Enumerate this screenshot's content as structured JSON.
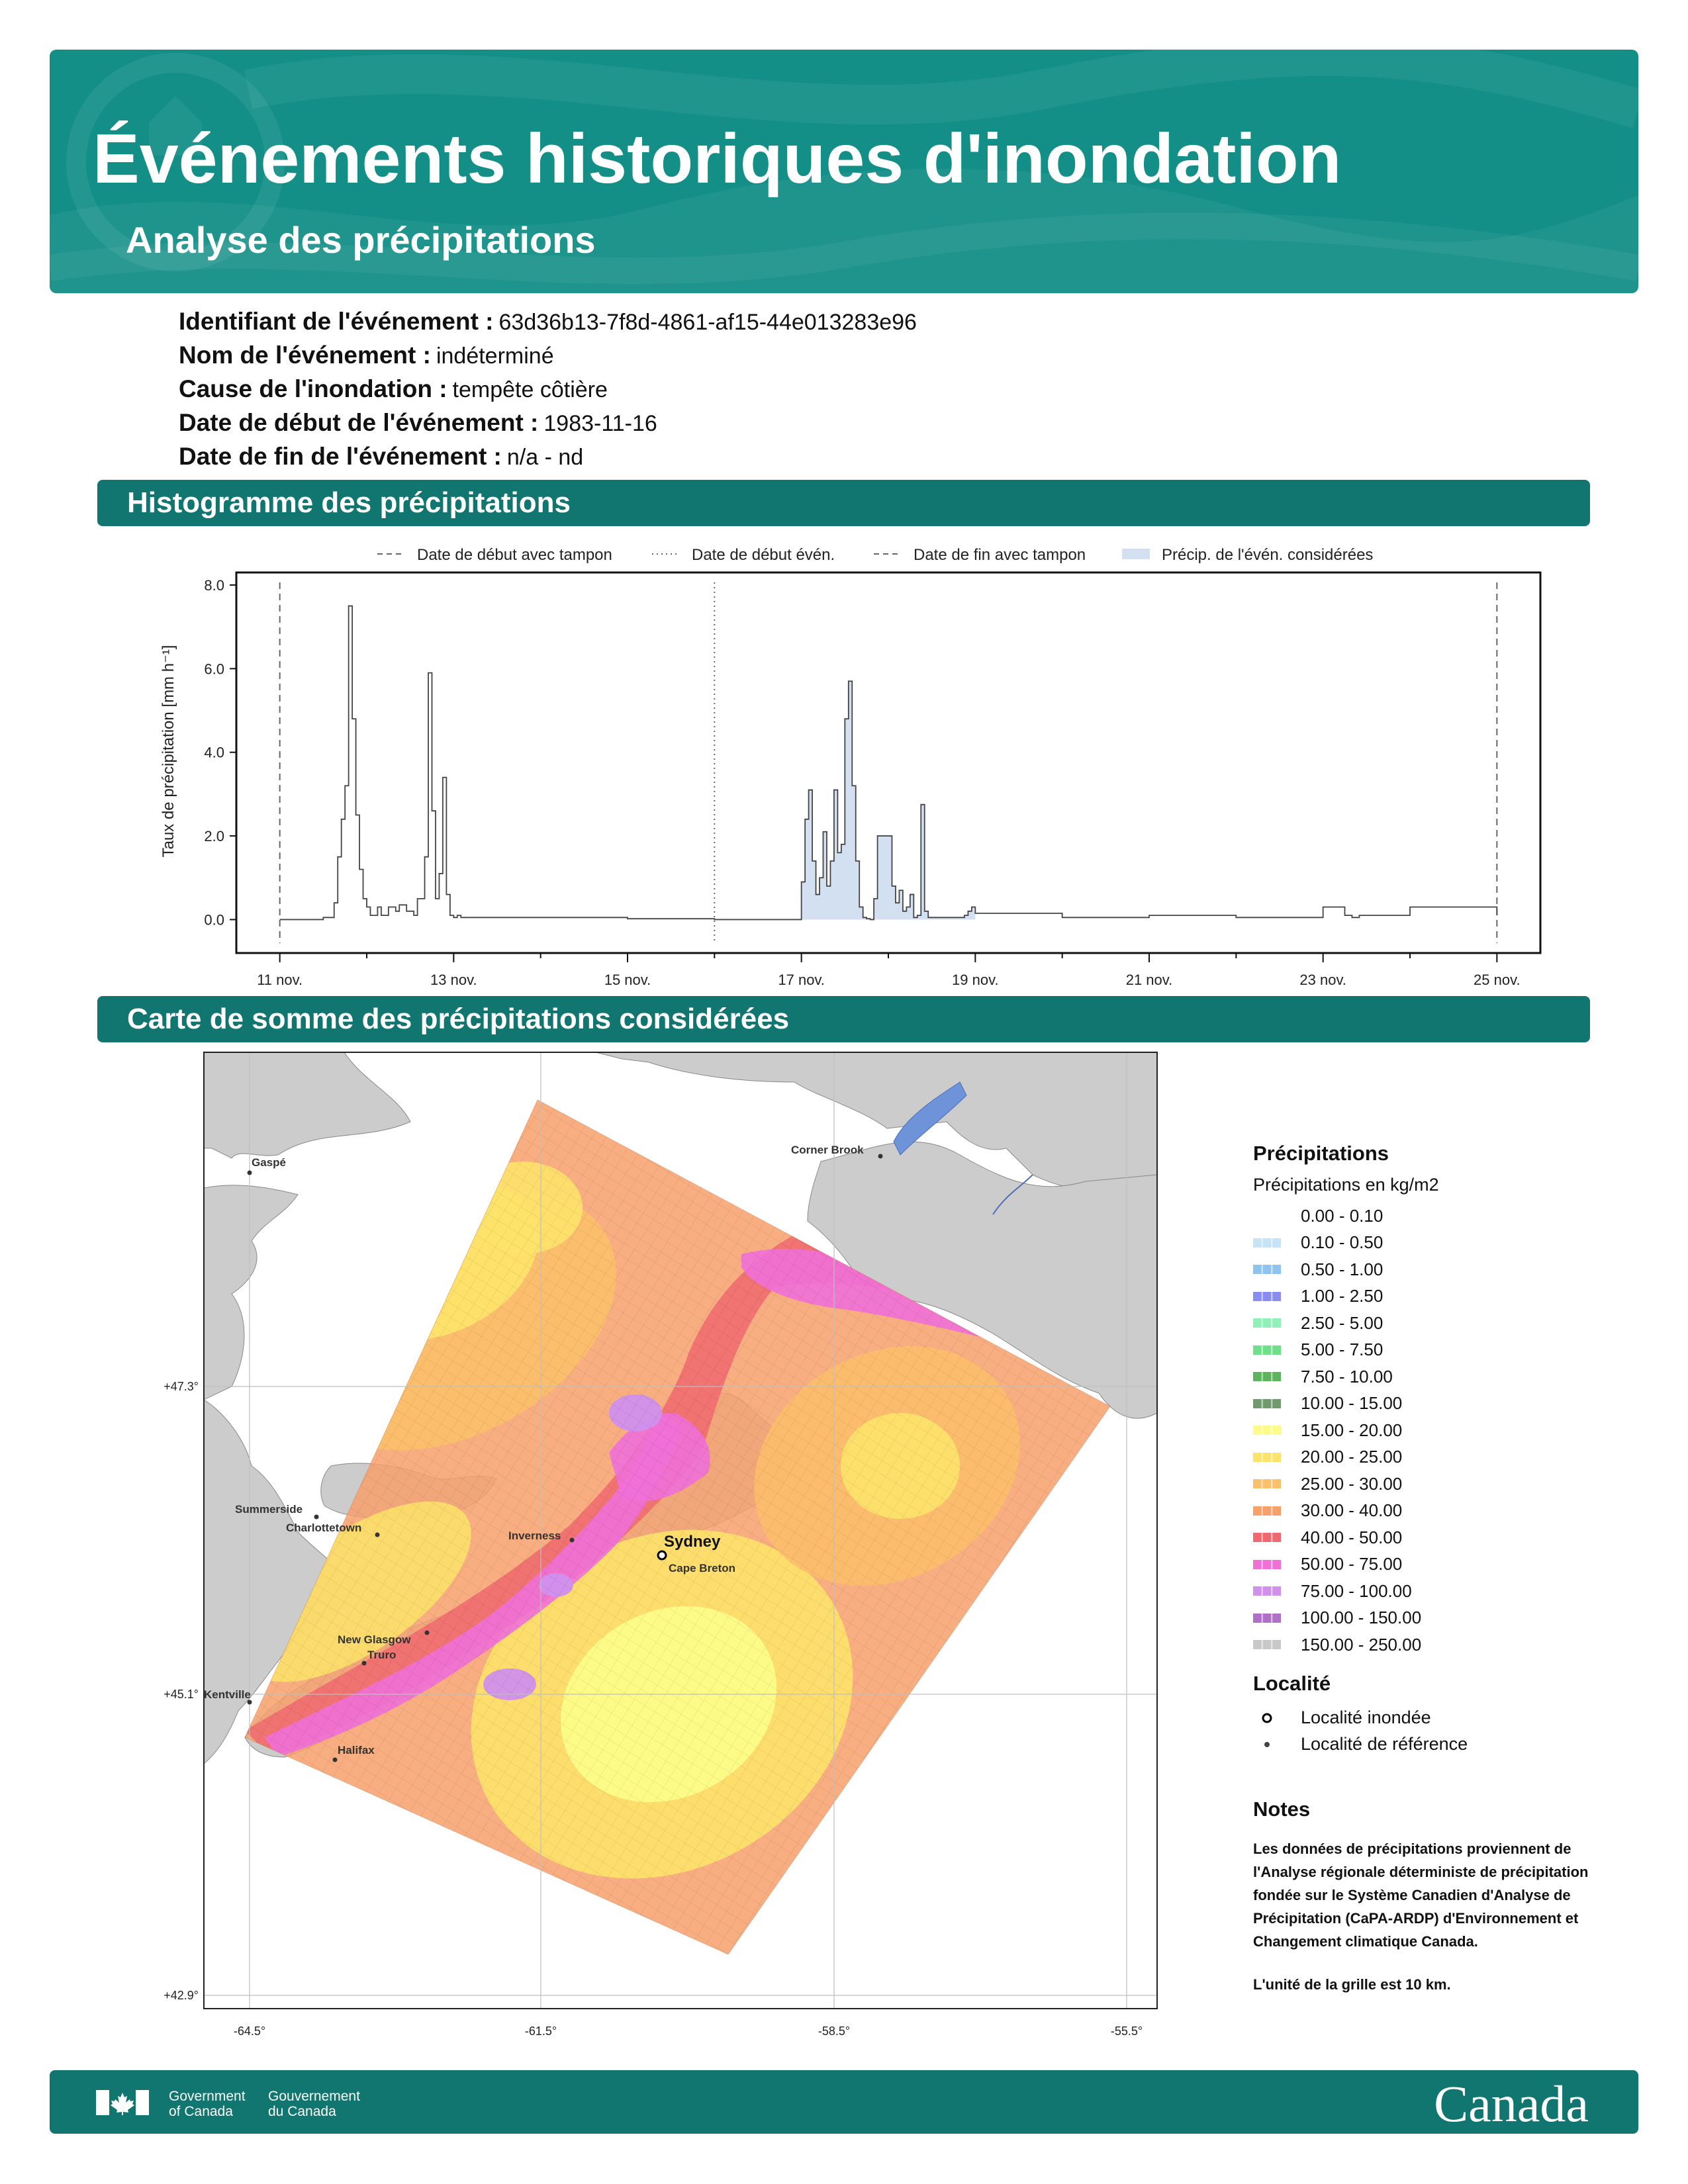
{
  "header": {
    "title": "Événements historiques d'inondation",
    "subtitle": "Analyse des précipitations"
  },
  "event": {
    "id_label": "Identifiant de l'événement :",
    "id_value": "63d36b13-7f8d-4861-af15-44e013283e96",
    "name_label": "Nom de l'événement :",
    "name_value": "indéterminé",
    "cause_label": "Cause de l'inondation :",
    "cause_value": "tempête côtière",
    "start_label": "Date de début de l'événement :",
    "start_value": "1983-11-16",
    "end_label": "Date de fin de l'événement :",
    "end_value": "n/a - nd"
  },
  "sections": {
    "histogram": "Histogramme des précipitations",
    "map": "Carte de somme des précipitations considérées"
  },
  "chart_data": {
    "type": "line",
    "ylabel": "Taux de précipitation [mm h⁻¹]",
    "ylim": [
      -0.8,
      8.3
    ],
    "yticks": [
      0.0,
      2.0,
      4.0,
      6.0,
      8.0
    ],
    "ytick_labels": [
      "0.0",
      "2.0",
      "4.0",
      "6.0",
      "8.0"
    ],
    "xlim": [
      "1983-11-10T12:00",
      "1983-11-25T12:00"
    ],
    "xticks": [
      "1983-11-11",
      "1983-11-13",
      "1983-11-15",
      "1983-11-17",
      "1983-11-19",
      "1983-11-21",
      "1983-11-23",
      "1983-11-25"
    ],
    "xtick_labels": [
      "11 nov.",
      "13 nov.",
      "15 nov.",
      "17 nov.",
      "19 nov.",
      "21 nov.",
      "23 nov.",
      "25 nov."
    ],
    "legend": [
      "Date de début avec tampon",
      "Date de début évén.",
      "Date de fin avec tampon",
      "Précip. de l'évén. considérées"
    ],
    "vlines": {
      "start_buffer": "1983-11-11T00:00",
      "event_start": "1983-11-16T00:00",
      "end_buffer": "1983-11-25T00:00"
    },
    "shaded_range": [
      "1983-11-17T00:00",
      "1983-11-19T00:00"
    ],
    "series": [
      {
        "x": [
          "1983-11-11T00:00",
          "1983-11-11T12:00",
          "1983-11-11T15:00",
          "1983-11-11T16:00",
          "1983-11-11T17:00",
          "1983-11-11T18:00",
          "1983-11-11T19:00",
          "1983-11-11T20:00",
          "1983-11-11T21:00",
          "1983-11-11T22:00",
          "1983-11-11T23:00",
          "1983-11-12T00:00",
          "1983-11-12T01:00",
          "1983-11-12T03:00",
          "1983-11-12T04:00",
          "1983-11-12T06:00",
          "1983-11-12T08:00",
          "1983-11-12T09:00",
          "1983-11-12T11:00",
          "1983-11-12T13:00",
          "1983-11-12T14:00",
          "1983-11-12T16:00",
          "1983-11-12T17:00",
          "1983-11-12T18:00",
          "1983-11-12T19:00",
          "1983-11-12T20:00",
          "1983-11-12T21:00",
          "1983-11-12T22:00",
          "1983-11-12T23:00",
          "1983-11-13T00:00",
          "1983-11-13T01:00",
          "1983-11-13T02:00",
          "1983-11-13T03:00",
          "1983-11-13T04:00",
          "1983-11-13T06:00",
          "1983-11-14T00:00",
          "1983-11-15T00:00",
          "1983-11-16T00:00",
          "1983-11-16T22:00",
          "1983-11-17T00:00",
          "1983-11-17T01:00",
          "1983-11-17T02:00",
          "1983-11-17T03:00",
          "1983-11-17T04:00",
          "1983-11-17T05:00",
          "1983-11-17T06:00",
          "1983-11-17T07:00",
          "1983-11-17T08:00",
          "1983-11-17T09:00",
          "1983-11-17T10:00",
          "1983-11-17T11:00",
          "1983-11-17T12:00",
          "1983-11-17T13:00",
          "1983-11-17T14:00",
          "1983-11-17T15:00",
          "1983-11-17T16:00",
          "1983-11-17T17:00",
          "1983-11-17T18:00",
          "1983-11-17T19:00",
          "1983-11-17T20:00",
          "1983-11-17T21:00",
          "1983-11-18T01:00",
          "1983-11-18T02:00",
          "1983-11-18T03:00",
          "1983-11-18T04:00",
          "1983-11-18T05:00",
          "1983-11-18T06:00",
          "1983-11-18T07:00",
          "1983-11-18T08:00",
          "1983-11-18T09:00",
          "1983-11-18T10:00",
          "1983-11-18T11:00",
          "1983-11-18T14:00",
          "1983-11-18T15:00",
          "1983-11-18T16:00",
          "1983-11-18T20:00",
          "1983-11-18T21:00",
          "1983-11-18T22:00",
          "1983-11-18T23:00",
          "1983-11-19T00:00",
          "1983-11-20T00:00",
          "1983-11-21T00:00",
          "1983-11-22T00:00",
          "1983-11-22T12:00",
          "1983-11-22T14:00",
          "1983-11-22T16:00",
          "1983-11-23T00:00",
          "1983-11-23T06:00",
          "1983-11-23T08:00",
          "1983-11-23T10:00",
          "1983-11-24T00:00",
          "1983-11-25T00:00"
        ],
        "y": [
          0.0,
          0.05,
          0.4,
          1.5,
          2.4,
          3.2,
          7.5,
          4.8,
          2.5,
          1.2,
          0.5,
          0.3,
          0.1,
          0.3,
          0.1,
          0.3,
          0.2,
          0.35,
          0.2,
          0.1,
          0.5,
          1.5,
          5.9,
          2.6,
          0.5,
          1.1,
          3.4,
          0.6,
          0.1,
          0.05,
          0.1,
          0.05,
          0.05,
          0.05,
          0.05,
          0.05,
          0.02,
          0.0,
          0.0,
          0.9,
          2.4,
          3.1,
          1.4,
          0.6,
          1.0,
          2.1,
          0.8,
          1.4,
          3.1,
          1.6,
          1.8,
          4.8,
          5.7,
          3.2,
          1.4,
          0.3,
          0.05,
          0.02,
          0.0,
          0.5,
          2.0,
          0.8,
          0.4,
          0.7,
          0.2,
          0.3,
          0.6,
          0.05,
          0.1,
          2.75,
          0.2,
          0.05,
          0.05,
          0.05,
          0.05,
          0.05,
          0.1,
          0.2,
          0.3,
          0.15,
          0.05,
          0.1,
          0.05,
          0.05,
          0.05,
          0.05,
          0.3,
          0.1,
          0.05,
          0.1,
          0.3,
          0.1
        ]
      }
    ]
  },
  "map": {
    "lon_labels": [
      "-64.5°",
      "-61.5°",
      "-58.5°",
      "-55.5°"
    ],
    "lat_labels": [
      "+47.3°",
      "+45.1°",
      "+42.9°"
    ],
    "places": {
      "gaspe": "Gaspé",
      "corner_brook": "Corner Brook",
      "summerside": "Summerside",
      "charlottetown": "Charlottetown",
      "inverness": "Inverness",
      "sydney": "Sydney",
      "cape_breton": "Cape Breton",
      "new_glasgow": "New Glasgow",
      "truro": "Truro",
      "kentville": "Kentville",
      "halifax": "Halifax"
    }
  },
  "legend": {
    "title": "Précipitations",
    "subtitle": "Précipitations en kg/m2",
    "classes": [
      {
        "label": "0.00 - 0.10",
        "color": "#ffffff"
      },
      {
        "label": "0.10 - 0.50",
        "color": "#c7e3f7"
      },
      {
        "label": "0.50 - 1.00",
        "color": "#8fc3ef"
      },
      {
        "label": "1.00 - 2.50",
        "color": "#8b8cf0"
      },
      {
        "label": "2.50 - 5.00",
        "color": "#8ff0b8"
      },
      {
        "label": "5.00 - 7.50",
        "color": "#6fe08a"
      },
      {
        "label": "7.50 - 10.00",
        "color": "#5cb45c"
      },
      {
        "label": "10.00 - 15.00",
        "color": "#6e9a6e"
      },
      {
        "label": "15.00 - 20.00",
        "color": "#fdfc8a"
      },
      {
        "label": "20.00 - 25.00",
        "color": "#fde36a"
      },
      {
        "label": "25.00 - 30.00",
        "color": "#fbc06a"
      },
      {
        "label": "30.00 - 40.00",
        "color": "#f7a06a"
      },
      {
        "label": "40.00 - 50.00",
        "color": "#f06870"
      },
      {
        "label": "50.00 - 75.00",
        "color": "#f070d8"
      },
      {
        "label": "75.00 - 100.00",
        "color": "#d090ec"
      },
      {
        "label": "100.00 - 150.00",
        "color": "#b070c8"
      },
      {
        "label": "150.00 - 250.00",
        "color": "#c8c8c8"
      }
    ],
    "locality_title": "Localité",
    "flooded": "Localité inondée",
    "reference": "Localité de référence"
  },
  "notes": {
    "title": "Notes",
    "text": "Les données de précipitations proviennent de l'Analyse régionale déterministe de précipitation fondée sur le Système Canadien d'Analyse de Précipitation (CaPA-ARDP) d'Environnement et Changement climatique Canada.",
    "unit": "L'unité de la grille est 10 km."
  },
  "footer": {
    "gov_en_1": "Government",
    "gov_en_2": "of Canada",
    "gov_fr_1": "Gouvernement",
    "gov_fr_2": "du Canada",
    "wordmark": "Canada"
  },
  "colors": {
    "header_bg": "#138f87",
    "section_bg": "#117570",
    "event_shade": "#d3e0f2",
    "land": "#cccccc",
    "water": "#ffffff"
  }
}
